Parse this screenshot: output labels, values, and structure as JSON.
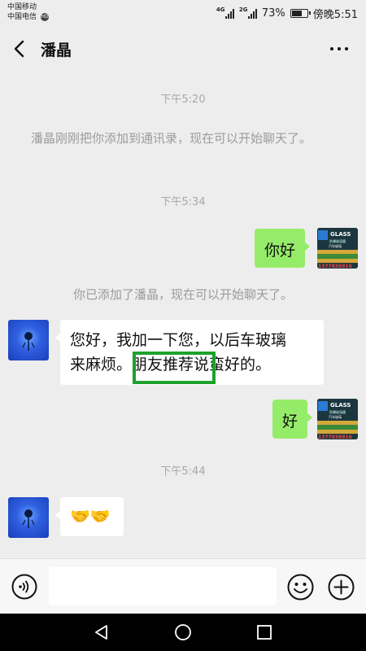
{
  "status_bar": {
    "carrier_1": "中国移动",
    "carrier_2": "中国电信",
    "hd_badge": "HD",
    "network_1": "4G",
    "network_2": "2G",
    "battery_percent": "73%",
    "battery_level": 0.73,
    "time": "傍晚5:51"
  },
  "header": {
    "title": "潘晶",
    "back_icon": "chevron-left-icon",
    "more_icon": "more-dots-icon"
  },
  "messages": {
    "time_1": "下午5:20",
    "system_1": "潘晶刚刚把你添加到通讯录，现在可以开始聊天了。",
    "time_2": "下午5:34",
    "sent_1": "你好",
    "system_2": "你已添加了潘晶，现在可以开始聊天了。",
    "received_1_line1": "您好，我加一下您，以后车玻璃",
    "received_1_line2_a": "来麻烦。",
    "received_1_line2_b": "朋友推荐",
    "received_1_line2_c": "说蛮好的。",
    "sent_2": "好",
    "time_3": "下午5:44",
    "received_2": "🤝🤝"
  },
  "self_avatar": {
    "brand": "GLASS",
    "line_1": "防爆玻璃膜",
    "line_2": "汽车玻璃",
    "phone": "1377836916"
  },
  "input_bar": {
    "value": "",
    "placeholder": "",
    "voice_icon": "voice-icon",
    "emoji_icon": "emoji-icon",
    "plus_icon": "plus-icon"
  },
  "nav_bar": {
    "back_icon": "nav-back-icon",
    "home_icon": "nav-home-icon",
    "recents_icon": "nav-recents-icon"
  },
  "colors": {
    "background": "#ededed",
    "sent_bubble": "#95ec69",
    "received_bubble": "#ffffff",
    "highlight": "#1da12c"
  }
}
